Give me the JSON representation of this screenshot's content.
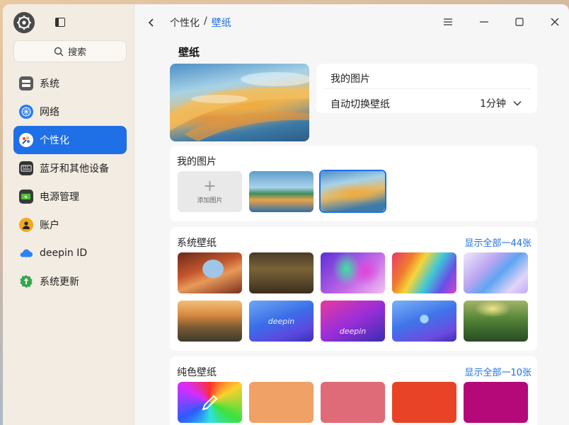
{
  "sidebar": {
    "search_label": "搜索",
    "items": [
      {
        "label": "系统",
        "icon": "system-icon"
      },
      {
        "label": "网络",
        "icon": "network-icon"
      },
      {
        "label": "个性化",
        "icon": "personalization-icon"
      },
      {
        "label": "蓝牙和其他设备",
        "icon": "bluetooth-devices-icon"
      },
      {
        "label": "电源管理",
        "icon": "power-icon"
      },
      {
        "label": "账户",
        "icon": "account-icon"
      },
      {
        "label": "deepin ID",
        "icon": "cloud-icon"
      },
      {
        "label": "系统更新",
        "icon": "update-icon"
      }
    ],
    "active_index": 2
  },
  "titlebar": {
    "breadcrumb_parent": "个性化",
    "breadcrumb_separator": "/",
    "breadcrumb_current": "壁纸"
  },
  "page": {
    "title": "壁纸",
    "my_pictures_label": "我的图片",
    "auto_switch_label": "自动切换壁纸",
    "auto_switch_value": "1分钟"
  },
  "my_pictures": {
    "title": "我的图片",
    "add_label": "添加图片"
  },
  "system_wallpapers": {
    "title": "系统壁纸",
    "show_all": "显示全部一44张",
    "tiles": [
      {
        "label": "",
        "theme": "canyon"
      },
      {
        "label": "",
        "theme": "forest"
      },
      {
        "label": "",
        "theme": "aurora"
      },
      {
        "label": "",
        "theme": "rainbow-prism"
      },
      {
        "label": "",
        "theme": "glass-blue"
      },
      {
        "label": "",
        "theme": "mountain-sunset"
      },
      {
        "label": "deepin",
        "theme": "deepin-blue"
      },
      {
        "label": "deepin",
        "theme": "deepin-magenta"
      },
      {
        "label": "",
        "theme": "deepin-logo-blue"
      },
      {
        "label": "",
        "theme": "green-valley"
      }
    ]
  },
  "solid_wallpapers": {
    "title": "纯色壁纸",
    "show_all": "显示全部一10张",
    "colors": [
      "#f0a166",
      "#e06b78",
      "#e84326",
      "#b5097a"
    ]
  },
  "colors": {
    "accent": "#1f6fe6"
  }
}
